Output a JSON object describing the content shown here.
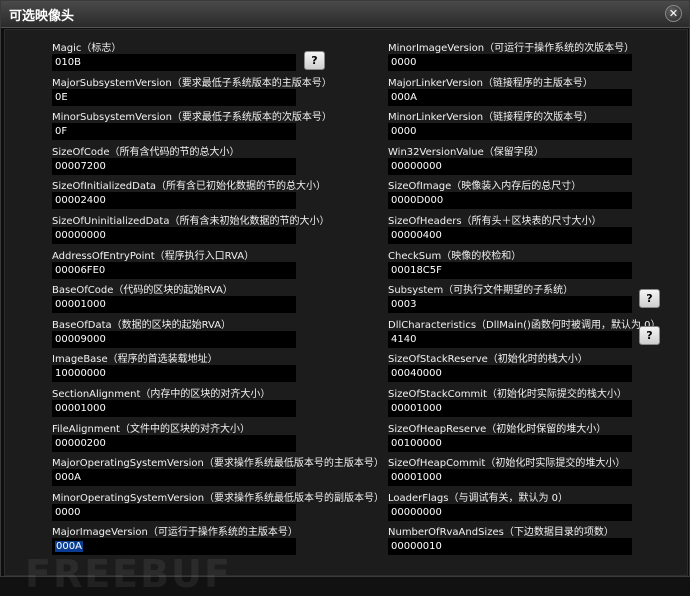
{
  "window": {
    "title": "可选映像头",
    "close_glyph": "✕",
    "help_glyph": "?"
  },
  "watermark": "FREEBUF",
  "left": [
    {
      "label": "Magic（标志）",
      "value": "010B"
    },
    {
      "label": "MajorSubsystemVersion（要求最低子系统版本的主版本号）",
      "value": "0E"
    },
    {
      "label": "MinorSubsystemVersion（要求最低子系统版本的次版本号）",
      "value": "0F"
    },
    {
      "label": "SizeOfCode（所有含代码的节的总大小）",
      "value": "00007200"
    },
    {
      "label": "SizeOfInitializedData（所有含已初始化数据的节的总大小）",
      "value": "00002400"
    },
    {
      "label": "SizeOfUninitializedData（所有含未初始化数据的节的大小）",
      "value": "00000000"
    },
    {
      "label": "AddressOfEntryPoint（程序执行入口RVA）",
      "value": "00006FE0"
    },
    {
      "label": "BaseOfCode（代码的区块的起始RVA）",
      "value": "00001000"
    },
    {
      "label": "BaseOfData（数据的区块的起始RVA）",
      "value": "00009000"
    },
    {
      "label": "ImageBase（程序的首选装载地址）",
      "value": "10000000"
    },
    {
      "label": "SectionAlignment（内存中的区块的对齐大小）",
      "value": "00001000"
    },
    {
      "label": "FileAlignment（文件中的区块的对齐大小）",
      "value": "00000200"
    },
    {
      "label": "MajorOperatingSystemVersion（要求操作系统最低版本号的主版本号）",
      "value": "000A"
    },
    {
      "label": "MinorOperatingSystemVersion（要求操作系统最低版本号的副版本号）",
      "value": "0000"
    },
    {
      "label": "MajorImageVersion（可运行于操作系统的主版本号）",
      "value": "000A"
    }
  ],
  "right": [
    {
      "label": "MinorImageVersion（可运行于操作系统的次版本号）",
      "value": "0000"
    },
    {
      "label": "MajorLinkerVersion（链接程序的主版本号）",
      "value": "000A"
    },
    {
      "label": "MinorLinkerVersion（链接程序的次版本号）",
      "value": "0000"
    },
    {
      "label": "Win32VersionValue（保留字段）",
      "value": "00000000"
    },
    {
      "label": "SizeOfImage（映像装入内存后的总尺寸）",
      "value": "0000D000"
    },
    {
      "label": "SizeOfHeaders（所有头＋区块表的尺寸大小）",
      "value": "00000400"
    },
    {
      "label": "CheckSum（映像的校检和）",
      "value": "00018C5F"
    },
    {
      "label": "Subsystem（可执行文件期望的子系统）",
      "value": "0003"
    },
    {
      "label": "DllCharacteristics（DllMain()函数何时被调用，默认为 0）",
      "value": "4140"
    },
    {
      "label": "SizeOfStackReserve（初始化时的栈大小）",
      "value": "00040000"
    },
    {
      "label": "SizeOfStackCommit（初始化时实际提交的栈大小）",
      "value": "00001000"
    },
    {
      "label": "SizeOfHeapReserve（初始化时保留的堆大小）",
      "value": "00100000"
    },
    {
      "label": "SizeOfHeapCommit（初始化时实际提交的堆大小）",
      "value": "00001000"
    },
    {
      "label": "LoaderFlags（与调试有关，默认为 0）",
      "value": "00000000"
    },
    {
      "label": "NumberOfRvaAndSizes（下边数据目录的项数）",
      "value": "00000010"
    }
  ]
}
